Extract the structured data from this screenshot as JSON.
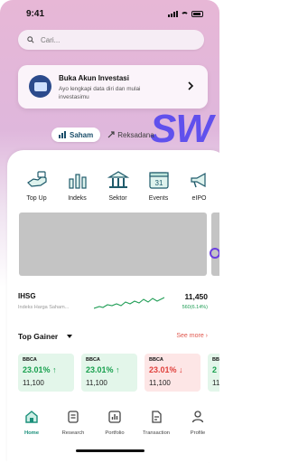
{
  "status": {
    "time": "9:41"
  },
  "search": {
    "placeholder": "Cari..."
  },
  "promo": {
    "title": "Buka Akun Investasi",
    "description": "Ayo lengkapi data diri dan mulai investasimu"
  },
  "segment": {
    "items": [
      {
        "label": "Saham",
        "active": true
      },
      {
        "label": "Reksadana",
        "active": false
      }
    ]
  },
  "hero_text": "SW",
  "menu": [
    {
      "label": "Top Up",
      "icon": "top-up-icon"
    },
    {
      "label": "Indeks",
      "icon": "chart-bars-icon"
    },
    {
      "label": "Sektor",
      "icon": "building-icon"
    },
    {
      "label": "Events",
      "icon": "calendar-icon",
      "day": "31"
    },
    {
      "label": "eIPO",
      "icon": "megaphone-icon"
    }
  ],
  "index": {
    "name": "IHSG",
    "subtitle": "Indeks Harga Saham...",
    "value": "11,450",
    "change": "560(6.14%)"
  },
  "top_gainer": {
    "title": "Top Gainer",
    "see_more": "See more",
    "cards": [
      {
        "ticker": "BBCA",
        "change": "23.01%",
        "price": "11,100",
        "direction": "up"
      },
      {
        "ticker": "BBCA",
        "change": "23.01%",
        "price": "11,100",
        "direction": "up"
      },
      {
        "ticker": "BBCA",
        "change": "23.01%",
        "price": "11,100",
        "direction": "down"
      },
      {
        "ticker": "BB",
        "change": "2",
        "price": "11",
        "direction": "up"
      }
    ]
  },
  "nav": [
    {
      "label": "Home",
      "icon": "home-icon",
      "active": true
    },
    {
      "label": "Research",
      "icon": "research-icon",
      "active": false
    },
    {
      "label": "Portfolio",
      "icon": "portfolio-icon",
      "active": false
    },
    {
      "label": "Transaction",
      "icon": "transaction-icon",
      "active": false
    },
    {
      "label": "Profile",
      "icon": "profile-icon",
      "active": false
    }
  ],
  "colors": {
    "accent": "#1a8f7a",
    "gain": "#18a04e",
    "loss": "#e0403c",
    "hero": "#4a3ff0"
  }
}
